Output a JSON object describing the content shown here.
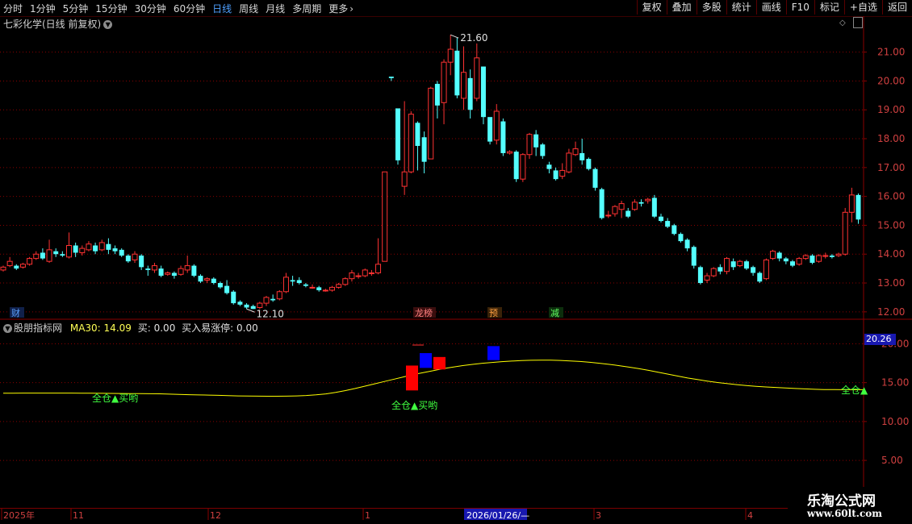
{
  "toolbar": {
    "periods": [
      "分时",
      "1分钟",
      "5分钟",
      "15分钟",
      "30分钟",
      "60分钟",
      "日线",
      "周线",
      "月线",
      "多周期",
      "更多"
    ],
    "active_period": "日线",
    "more_chevron_icon": "chevron-right-icon",
    "right_buttons": [
      "复权",
      "叠加",
      "多股",
      "统计",
      "画线",
      "F10",
      "标记",
      "+自选",
      "返回"
    ]
  },
  "chart_title": "七彩化学(日线 前复权)",
  "price_axis": {
    "labels": [
      "21.00",
      "20.00",
      "19.00",
      "18.00",
      "17.00",
      "16.00",
      "15.00",
      "14.00",
      "13.00",
      "12.00"
    ],
    "range": [
      11.8,
      21.8
    ]
  },
  "price_marks": {
    "high": "21.60",
    "low": "12.10"
  },
  "event_tags": {
    "cai": "财",
    "long": "龙榜",
    "yu": "预",
    "jian": "减"
  },
  "indicator": {
    "name": "股朋指标网",
    "ma_label": "MA30:",
    "ma_value": "14.09",
    "buy_label": "买:",
    "buy_value": "0.00",
    "zt_label": "买入易涨停:",
    "zt_value": "0.00",
    "axis_labels": [
      "20.00",
      "15.00",
      "10.00",
      "5.00"
    ],
    "current_value": "20.26",
    "full_buy_text": "全仓▲买哟",
    "full_text_short": "全仓▲"
  },
  "date_axis": [
    "2025年",
    "11",
    "12",
    "1",
    "2026/01/26/—",
    "3",
    "4"
  ],
  "watermark": {
    "title": "乐淘公式网",
    "url": "www.60lt.com"
  },
  "chart_data": {
    "type": "candlestick",
    "series": [
      {
        "name": "日K",
        "values": [
          [
            13.45,
            13.55,
            13.4,
            13.6
          ],
          [
            13.6,
            13.75,
            13.55,
            13.9
          ],
          [
            13.6,
            13.5,
            13.45,
            13.65
          ],
          [
            13.55,
            13.65,
            13.5,
            13.7
          ],
          [
            13.65,
            13.85,
            13.6,
            13.9
          ],
          [
            13.85,
            14.0,
            13.8,
            14.1
          ],
          [
            14.05,
            13.85,
            13.8,
            14.2
          ],
          [
            13.75,
            14.15,
            13.7,
            14.5
          ],
          [
            14.1,
            14.0,
            13.9,
            14.2
          ],
          [
            14.0,
            13.95,
            13.9,
            14.1
          ],
          [
            13.9,
            14.3,
            13.85,
            14.75
          ],
          [
            14.3,
            14.05,
            13.9,
            14.4
          ],
          [
            14.05,
            14.2,
            13.95,
            14.3
          ],
          [
            14.15,
            14.35,
            14.1,
            14.45
          ],
          [
            14.3,
            14.1,
            14.0,
            14.4
          ],
          [
            14.15,
            14.4,
            14.1,
            14.5
          ],
          [
            14.35,
            14.15,
            14.0,
            14.55
          ],
          [
            14.2,
            14.1,
            14.0,
            14.3
          ],
          [
            14.15,
            13.95,
            13.9,
            14.2
          ],
          [
            13.95,
            13.75,
            13.7,
            14.0
          ],
          [
            13.8,
            14.0,
            13.7,
            14.1
          ],
          [
            13.95,
            13.55,
            13.45,
            14.0
          ],
          [
            13.5,
            13.45,
            13.25,
            13.6
          ],
          [
            13.45,
            13.6,
            13.35,
            13.7
          ],
          [
            13.5,
            13.25,
            13.2,
            13.6
          ],
          [
            13.3,
            13.35,
            13.25,
            13.4
          ],
          [
            13.35,
            13.25,
            13.15,
            13.4
          ],
          [
            13.3,
            13.5,
            13.25,
            13.6
          ],
          [
            13.45,
            13.6,
            13.35,
            13.95
          ],
          [
            13.6,
            13.25,
            13.2,
            13.65
          ],
          [
            13.25,
            13.05,
            13.0,
            13.3
          ],
          [
            13.1,
            13.15,
            13.0,
            13.2
          ],
          [
            13.15,
            13.0,
            12.95,
            13.2
          ],
          [
            13.0,
            12.85,
            12.8,
            13.05
          ],
          [
            12.9,
            12.65,
            12.6,
            13.1
          ],
          [
            12.7,
            12.3,
            12.25,
            12.75
          ],
          [
            12.35,
            12.25,
            12.2,
            12.4
          ],
          [
            12.25,
            12.15,
            12.1,
            12.3
          ],
          [
            12.2,
            12.1,
            12.1,
            12.25
          ],
          [
            12.15,
            12.3,
            12.1,
            12.35
          ],
          [
            12.3,
            12.5,
            12.2,
            12.55
          ],
          [
            12.45,
            12.4,
            12.35,
            12.6
          ],
          [
            12.45,
            12.7,
            12.4,
            12.75
          ],
          [
            12.7,
            13.2,
            12.65,
            13.35
          ],
          [
            13.1,
            13.05,
            12.9,
            13.25
          ],
          [
            13.1,
            13.0,
            12.95,
            13.2
          ],
          [
            12.95,
            12.9,
            12.85,
            13.0
          ],
          [
            12.85,
            12.85,
            12.8,
            12.95
          ],
          [
            12.85,
            12.75,
            12.7,
            12.9
          ],
          [
            12.75,
            12.75,
            12.7,
            12.8
          ],
          [
            12.75,
            12.85,
            12.7,
            12.9
          ],
          [
            12.85,
            12.95,
            12.8,
            13.0
          ],
          [
            12.95,
            13.15,
            12.9,
            13.2
          ],
          [
            13.15,
            13.35,
            13.05,
            13.45
          ],
          [
            13.25,
            13.25,
            13.15,
            13.35
          ],
          [
            13.25,
            13.45,
            13.2,
            13.5
          ],
          [
            13.35,
            13.35,
            13.25,
            13.45
          ],
          [
            13.35,
            13.65,
            13.3,
            14.55
          ],
          [
            13.75,
            16.85,
            13.75,
            16.85
          ],
          [
            20.15,
            20.1,
            20.0,
            20.15
          ],
          [
            19.05,
            17.25,
            17.1,
            19.05
          ],
          [
            16.35,
            16.85,
            16.05,
            19.3
          ],
          [
            16.85,
            18.85,
            16.8,
            18.95
          ],
          [
            18.55,
            17.75,
            16.9,
            18.6
          ],
          [
            18.05,
            17.2,
            16.8,
            18.25
          ],
          [
            17.3,
            19.75,
            17.3,
            19.8
          ],
          [
            19.9,
            19.15,
            18.7,
            20.0
          ],
          [
            19.25,
            20.65,
            18.5,
            20.75
          ],
          [
            20.65,
            21.1,
            20.2,
            21.6
          ],
          [
            21.05,
            19.5,
            19.4,
            21.5
          ],
          [
            19.4,
            20.3,
            19.0,
            21.2
          ],
          [
            20.1,
            19.0,
            18.7,
            20.4
          ],
          [
            19.4,
            20.8,
            19.3,
            21.3
          ],
          [
            20.5,
            18.75,
            18.5,
            20.5
          ],
          [
            18.75,
            17.9,
            17.8,
            18.7
          ],
          [
            17.95,
            18.95,
            17.8,
            19.2
          ],
          [
            18.6,
            17.5,
            17.4,
            18.7
          ],
          [
            17.5,
            17.55,
            17.45,
            17.6
          ],
          [
            17.55,
            16.6,
            16.5,
            17.6
          ],
          [
            16.6,
            17.45,
            16.5,
            17.5
          ],
          [
            17.45,
            18.15,
            17.3,
            18.2
          ],
          [
            18.15,
            17.7,
            17.4,
            18.3
          ],
          [
            17.8,
            17.4,
            17.3,
            17.85
          ],
          [
            17.1,
            16.95,
            16.8,
            17.2
          ],
          [
            16.9,
            16.6,
            16.55,
            17.0
          ],
          [
            16.7,
            16.9,
            16.6,
            17.15
          ],
          [
            16.85,
            17.5,
            16.8,
            17.65
          ],
          [
            17.45,
            17.65,
            17.4,
            17.9
          ],
          [
            17.5,
            17.25,
            17.1,
            18.0
          ],
          [
            17.3,
            16.95,
            16.9,
            17.35
          ],
          [
            16.95,
            16.3,
            16.2,
            17.0
          ],
          [
            16.25,
            15.25,
            15.2,
            16.3
          ],
          [
            15.35,
            15.35,
            15.25,
            15.5
          ],
          [
            15.4,
            15.65,
            15.3,
            15.7
          ],
          [
            15.55,
            15.75,
            15.25,
            15.85
          ],
          [
            15.5,
            15.3,
            15.25,
            15.6
          ],
          [
            15.55,
            15.8,
            15.5,
            15.9
          ],
          [
            15.8,
            15.75,
            15.65,
            15.9
          ],
          [
            15.85,
            15.9,
            15.75,
            15.95
          ],
          [
            15.95,
            15.3,
            15.25,
            16.05
          ],
          [
            15.3,
            15.15,
            15.1,
            15.4
          ],
          [
            15.15,
            14.95,
            14.9,
            15.25
          ],
          [
            15.0,
            14.7,
            14.65,
            15.05
          ],
          [
            14.7,
            14.45,
            14.4,
            14.75
          ],
          [
            14.5,
            14.2,
            14.1,
            14.55
          ],
          [
            14.25,
            13.6,
            13.5,
            14.3
          ],
          [
            13.55,
            13.0,
            12.95,
            13.6
          ],
          [
            13.1,
            13.25,
            13.0,
            13.35
          ],
          [
            13.25,
            13.5,
            13.2,
            13.55
          ],
          [
            13.55,
            13.4,
            13.3,
            13.65
          ],
          [
            13.4,
            13.85,
            13.3,
            13.9
          ],
          [
            13.75,
            13.55,
            13.45,
            13.85
          ],
          [
            13.6,
            13.75,
            13.55,
            13.8
          ],
          [
            13.75,
            13.5,
            13.45,
            13.8
          ],
          [
            13.55,
            13.35,
            13.25,
            13.6
          ],
          [
            13.35,
            13.05,
            13.0,
            13.4
          ],
          [
            13.15,
            13.8,
            13.1,
            13.85
          ],
          [
            13.85,
            14.1,
            13.8,
            14.15
          ],
          [
            14.05,
            13.85,
            13.75,
            14.1
          ],
          [
            13.85,
            13.75,
            13.65,
            13.9
          ],
          [
            13.75,
            13.6,
            13.55,
            13.8
          ],
          [
            13.65,
            13.85,
            13.6,
            13.9
          ],
          [
            13.85,
            13.95,
            13.8,
            14.0
          ],
          [
            13.95,
            13.7,
            13.65,
            14.0
          ],
          [
            13.75,
            13.95,
            13.7,
            14.0
          ],
          [
            13.95,
            13.95,
            13.85,
            14.05
          ],
          [
            13.95,
            13.9,
            13.85,
            14.0
          ],
          [
            13.95,
            14.0,
            13.9,
            14.05
          ],
          [
            14.0,
            15.45,
            13.95,
            15.6
          ],
          [
            15.45,
            16.05,
            15.1,
            16.3
          ],
          [
            16.05,
            15.2,
            15.05,
            16.1
          ]
        ]
      }
    ],
    "ma30": [
      13.65,
      13.65,
      13.66,
      13.66,
      13.66,
      13.66,
      13.66,
      13.66,
      13.65,
      13.64,
      13.63,
      13.62,
      13.61,
      13.6,
      13.6,
      13.58,
      13.56,
      13.52,
      13.49,
      13.45,
      13.42,
      13.4,
      13.37,
      13.33,
      13.3,
      13.28,
      13.26,
      13.25,
      13.25,
      13.26,
      13.3,
      13.35,
      13.43,
      13.55,
      13.75,
      13.98,
      14.25,
      14.55,
      14.85,
      15.15,
      15.45,
      15.75,
      16.05,
      16.3,
      16.55,
      16.8,
      17.0,
      17.2,
      17.35,
      17.5,
      17.6,
      17.7,
      17.78,
      17.85,
      17.88,
      17.9,
      17.89,
      17.86,
      17.8,
      17.72,
      17.62,
      17.5,
      17.35,
      17.18,
      17.0,
      16.8,
      16.58,
      16.35,
      16.1,
      15.85,
      15.6,
      15.4,
      15.2,
      15.03,
      14.88,
      14.75,
      14.63,
      14.53,
      14.45,
      14.38,
      14.31,
      14.25,
      14.2,
      14.15,
      14.12,
      14.1,
      14.09,
      14.09,
      14.09
    ],
    "signals": [
      {
        "type": "red",
        "top": 17.2,
        "bottom": 14.0
      },
      {
        "type": "blue",
        "top": 18.8,
        "bottom": 16.9
      },
      {
        "type": "red",
        "top": 18.3,
        "bottom": 16.7
      },
      {
        "type": "blue",
        "top": 19.7,
        "bottom": 17.9
      }
    ],
    "ind_range": [
      2.0,
      21.5
    ],
    "colors": {
      "up": "#ff3232",
      "down": "#54ffff",
      "ma": "#ffff00",
      "grid": "#8a0000",
      "buy_text": "#40ff40",
      "signal_red": "#ff0000",
      "signal_blue": "#0000ff"
    }
  }
}
